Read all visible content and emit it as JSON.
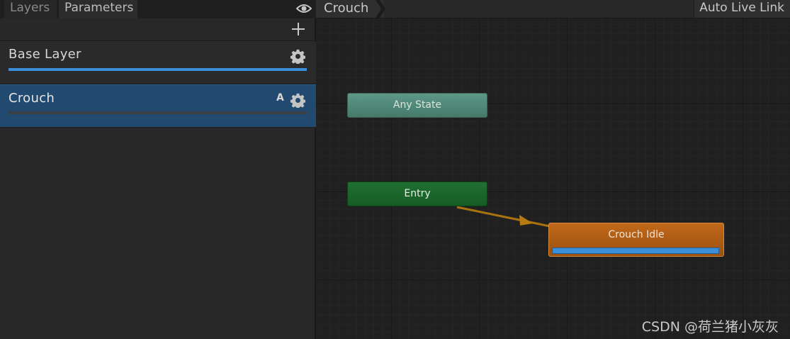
{
  "layers_panel": {
    "tabs": [
      "Layers",
      "Parameters"
    ],
    "layers": [
      {
        "name": "Base Layer",
        "weight": 1.0,
        "selected": false,
        "badge": ""
      },
      {
        "name": "Crouch",
        "weight": 0.0,
        "selected": true,
        "badge": "A"
      }
    ]
  },
  "graph": {
    "breadcrumb": "Crouch",
    "auto_live_link": "Auto Live Link",
    "states": {
      "any_state": "Any State",
      "entry": "Entry",
      "crouch_idle": {
        "label": "Crouch Idle",
        "progress": 1.0
      }
    }
  },
  "watermark": "CSDN @荷兰猪小灰灰",
  "colors": {
    "any_state": "#5e9887",
    "entry": "#217032",
    "default_state": "#c0681a",
    "selected_layer": "#224a70",
    "weight_bar": "#3a8fd8",
    "transition": "#b57a12"
  },
  "icons": [
    "eye-icon",
    "plus-icon",
    "gear-icon",
    "breadcrumb-arrow-icon"
  ]
}
